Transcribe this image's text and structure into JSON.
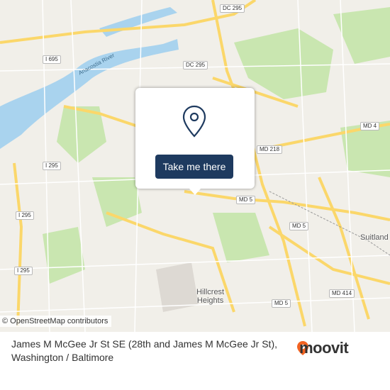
{
  "map": {
    "river_label": "Anacostia River",
    "place_labels": [
      {
        "id": "suitland",
        "text": "Suitland"
      },
      {
        "id": "hillcrest",
        "text": "Hillcrest\nHeights"
      }
    ],
    "shields": [
      {
        "id": "dc295-top",
        "text": "DC 295"
      },
      {
        "id": "i695",
        "text": "I 695"
      },
      {
        "id": "dc295-mid",
        "text": "DC 295"
      },
      {
        "id": "md4",
        "text": "MD 4"
      },
      {
        "id": "md218",
        "text": "MD 218"
      },
      {
        "id": "i295-a",
        "text": "I 295"
      },
      {
        "id": "md5-a",
        "text": "MD 5"
      },
      {
        "id": "i295-b",
        "text": "I 295"
      },
      {
        "id": "md5-b",
        "text": "MD 5"
      },
      {
        "id": "i295-c",
        "text": "I 295"
      },
      {
        "id": "md414",
        "text": "MD 414"
      },
      {
        "id": "md5-c",
        "text": "MD 5"
      }
    ],
    "colors": {
      "water": "#a9d3ee",
      "park": "#c9e6b0",
      "road_major": "#fbd76a",
      "road_minor": "#ffffff",
      "land": "#f1efe9"
    }
  },
  "popup": {
    "icon": "location-pin-icon",
    "button_label": "Take me there"
  },
  "attribution": {
    "symbol": "©",
    "text": "OpenStreetMap contributors"
  },
  "footer": {
    "title": "James M McGee Jr St SE (28th and James M McGee Jr St), Washington / Baltimore",
    "brand": "moovit",
    "brand_color": "#f26322"
  }
}
